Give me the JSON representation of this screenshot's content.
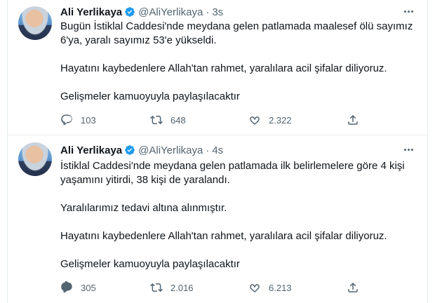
{
  "tweets": [
    {
      "author_name": "Ali Yerlikaya",
      "handle": "@AliYerlikaya",
      "separator": "·",
      "time": "3s",
      "paragraphs": [
        "Bugün İstiklal Caddesi'nde meydana gelen patlamada maalesef ölü sayımız 6'ya, yaralı sayımız 53'e yükseldi.",
        "Hayatını kaybedenlere Allah'tan rahmet, yaralılara acil şifalar diliyoruz.",
        "Gelişmeler kamuoyuyla paylaşılacaktır"
      ],
      "replies": "103",
      "retweets": "648",
      "likes": "2.322"
    },
    {
      "author_name": "Ali Yerlikaya",
      "handle": "@AliYerlikaya",
      "separator": "·",
      "time": "4s",
      "paragraphs": [
        "İstiklal Caddesi'nde meydana gelen patlamada ilk belirlemelere göre 4 kişi yaşamını yitirdi, 38 kişi de yaralandı.",
        "Yaralılarımız tedavi altına alınmıştır.",
        "Hayatını kaybedenlere Allah'tan rahmet, yaralılara acil şifalar diliyoruz.",
        "Gelişmeler kamuoyuyla paylaşılacaktır"
      ],
      "replies": "305",
      "retweets": "2.016",
      "likes": "6.213"
    }
  ],
  "icons": {
    "verified": "verified-badge-icon",
    "more": "more-options-icon",
    "reply": "reply-icon",
    "retweet": "retweet-icon",
    "like": "heart-icon",
    "share": "share-icon"
  },
  "colors": {
    "verified": "#1d9bf0",
    "text": "#0f1419",
    "secondary": "#536471",
    "divider": "#e6ecf0"
  }
}
